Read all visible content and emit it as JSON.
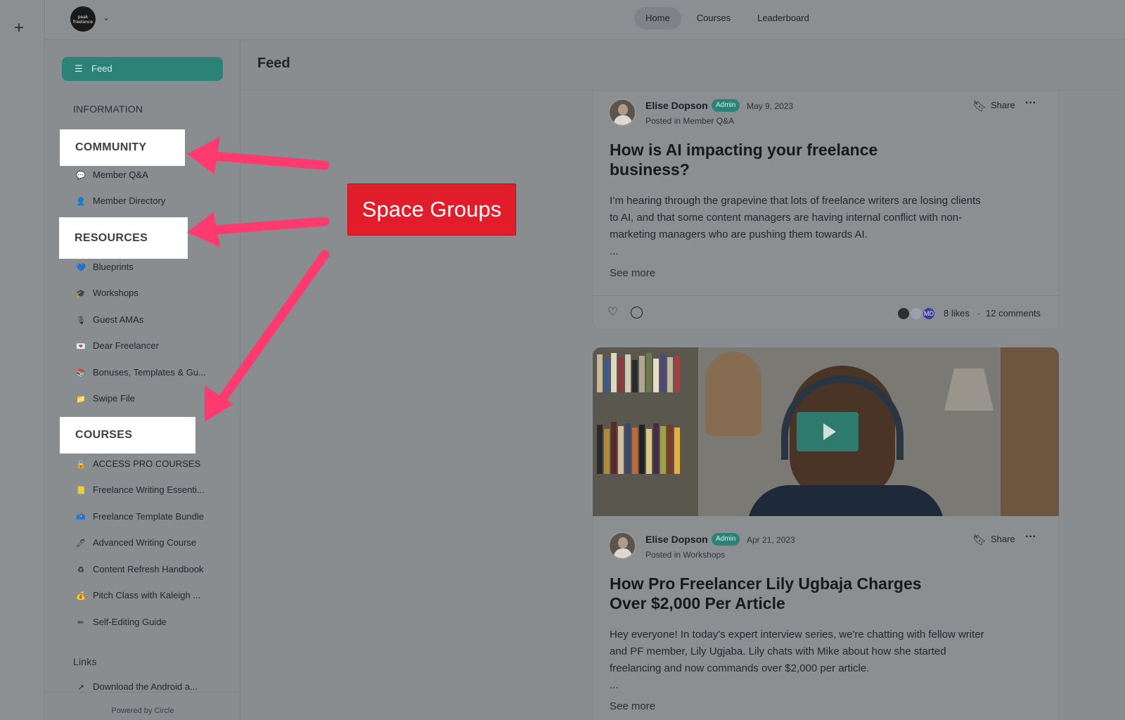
{
  "app": {
    "logo_text": "peak freelance",
    "top_nav": [
      {
        "label": "Home",
        "active": true
      },
      {
        "label": "Courses",
        "active": false
      },
      {
        "label": "Leaderboard",
        "active": false
      }
    ]
  },
  "sidebar": {
    "feed_label": "Feed",
    "information_label": "INFORMATION",
    "groups": {
      "community": "COMMUNITY",
      "resources": "RESOURCES",
      "courses": "COURSES"
    },
    "community_items": [
      {
        "icon": "speech-bubble-icon",
        "label": "Member Q&A"
      },
      {
        "icon": "person-icon",
        "label": "Member Directory"
      }
    ],
    "resource_items": [
      {
        "icon": "heart-icon",
        "label": "Blueprints"
      },
      {
        "icon": "grad-cap-icon",
        "label": "Workshops"
      },
      {
        "icon": "mic-icon",
        "label": "Guest AMAs"
      },
      {
        "icon": "love-letter-icon",
        "label": "Dear Freelancer"
      },
      {
        "icon": "books-icon",
        "label": "Bonuses, Templates & Gu..."
      },
      {
        "icon": "folder-icon",
        "label": "Swipe File"
      }
    ],
    "course_items": [
      {
        "icon": "lock-icon",
        "label": "ACCESS PRO COURSES"
      },
      {
        "icon": "notebook-icon",
        "label": "Freelance Writing Essenti..."
      },
      {
        "icon": "mailbox-icon",
        "label": "Freelance Template Bundle"
      },
      {
        "icon": "pen-icon",
        "label": "Advanced Writing Course"
      },
      {
        "icon": "recycle-icon",
        "label": "Content Refresh Handbook"
      },
      {
        "icon": "money-bag-icon",
        "label": "Pitch Class with Kaleigh ..."
      },
      {
        "icon": "pencil-icon",
        "label": "Self-Editing Guide"
      }
    ],
    "links_label": "Links",
    "link_items": [
      {
        "icon": "arrow-out-icon",
        "label": "Download the Android a..."
      }
    ],
    "powered_by": "Powered by Circle"
  },
  "main": {
    "title": "Feed",
    "posts": [
      {
        "author": "Elise Dopson",
        "badge": "Admin",
        "date": "May 9, 2023",
        "posted_in": "Posted in Member Q&A",
        "bookmark_label": "",
        "share_label": "Share",
        "more_label": "···",
        "title_lines": [
          "How is AI impacting your freelance",
          "business?"
        ],
        "body_lines": [
          "I’m hearing through the grapevine that lots of freelance writers are losing clients",
          "to AI, and that some content managers are having internal conflict with non-",
          "marketing managers who are pushing them towards AI.",
          "..."
        ],
        "see_more": "See more",
        "likes": "8 likes",
        "separator": "·",
        "comments": "12 comments",
        "avatar_initials": "MD"
      },
      {
        "author": "Elise Dopson",
        "badge": "Admin",
        "date": "Apr 21, 2023",
        "posted_in": "Posted in Workshops",
        "share_label": "Share",
        "more_label": "···",
        "title_lines": [
          "How Pro Freelancer Lily Ugbaja Charges",
          "Over $2,000 Per Article"
        ],
        "body_lines": [
          "Hey everyone! In today's expert interview series, we're chatting with fellow writer",
          "and PF member, Lily Ugjaba. Lily chats with Mike about how she started",
          "freelancing and now commands over $2,000 per article.",
          "..."
        ],
        "see_more": "See more"
      }
    ]
  },
  "annotation": {
    "callout": "Space Groups",
    "arrow_color": "#ff3a6e",
    "callout_color": "#e11d2b"
  }
}
